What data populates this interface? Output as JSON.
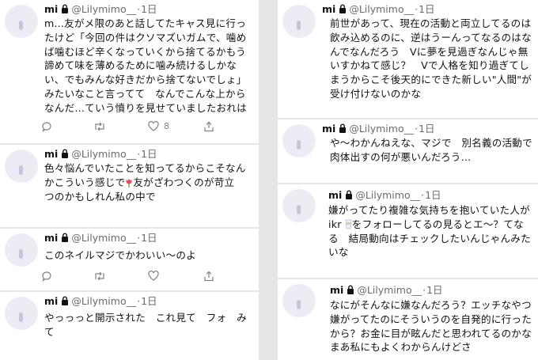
{
  "tweets": [
    {
      "name": "mi",
      "handle": "@Lilymimo__",
      "sep": "·",
      "time": "1日",
      "lines": [
        "m...友がメ限のあと話してたキャス見に行っ",
        "たけど「今回の件はクソマズいガムで、噛め",
        "ば噛むほど辛くなっていくから捨てるかもう",
        "諦めて味を薄めるために噛み続けるしかな",
        "い、でもみんな好きだから捨てないでしょ」",
        "みたいなこと言ってて　なんでこんな上から",
        "なんだ…ていう憤りを見せていましたおれは"
      ],
      "like_count": "8"
    },
    {
      "name": "mi",
      "handle": "@Lilymimo__",
      "sep": "·",
      "time": "1日",
      "line1": "色々悩んでいたことを知ってるからこそなん",
      "line2a": "かこういう感じで",
      "line2b": "友がざわつくのが苛立",
      "line3": "つのかもしれん私の中で"
    },
    {
      "name": "mi",
      "handle": "@Lilymimo__",
      "sep": "·",
      "time": "1日",
      "lines": [
        "このネイルマジでかわいい〜のよ"
      ]
    },
    {
      "name": "mi",
      "handle": "@Lilymimo__",
      "sep": "·",
      "time": "1日",
      "lines": [
        "やっっっと開示された　これ見て　フォ　み",
        "て"
      ]
    },
    {
      "name": "mi",
      "handle": "@Lilymimo__",
      "sep": "·",
      "time": "1日",
      "lines": [
        "前世があって、現在の活動と両立してるのは",
        "飲み込めるのに、逆はうーんってなるのはな",
        "んでなんだろう　Vに夢を見過ぎなんじゃ無",
        "いすかねて感じ？　Vで人格を知り過ぎてし",
        "まうからこそ後天的にできた新しい\"人間\"が",
        "受け付けないのかな"
      ]
    },
    {
      "name": "mi",
      "handle": "@Lilymimo__",
      "sep": "·",
      "time": "1日",
      "lines": [
        "や〜わかんねえな、マジで　別名義の活動で",
        "肉体出すの何が悪いんだろう…"
      ]
    },
    {
      "name": "mi",
      "handle": "@Lilymimo__",
      "sep": "·",
      "time": "1日",
      "line1": "嫌がってたり複雑な気持ちを抱いていた人が",
      "line2a": "ikr",
      "line2b": "をフォローしてるの見るとエ〜？てな",
      "line3": "る　結局動向はチェックしたいんじゃんみた",
      "line4": "いな"
    },
    {
      "name": "mi",
      "handle": "@Lilymimo__",
      "sep": "·",
      "time": "1日",
      "lines": [
        "なにがそんなに嫌なんだろう？エッチなやつ",
        "嫌がってたのにそういうのを自発的に行った",
        "から？お金に目が眩んだと思われてるのかな",
        "まあ私にもよくわからんけどさ"
      ]
    }
  ]
}
